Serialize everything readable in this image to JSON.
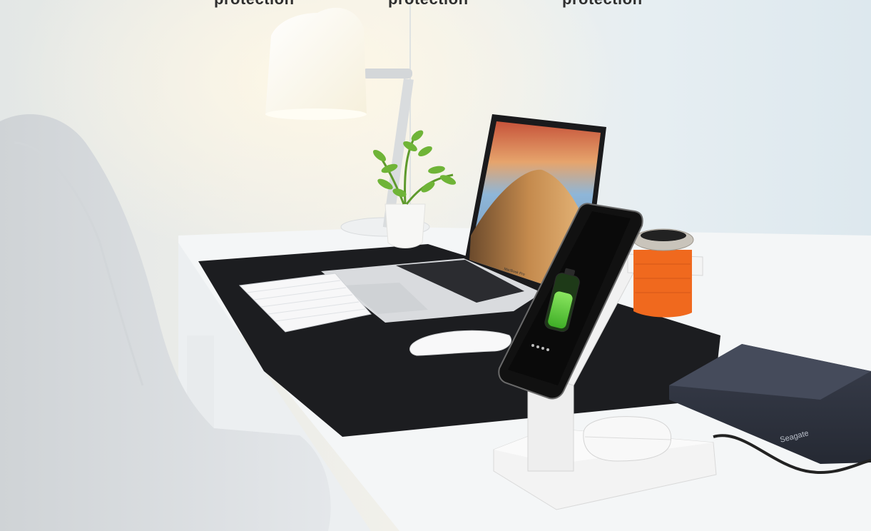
{
  "captions": [
    "protection",
    "protection",
    "protection"
  ],
  "device_brand": "Seagate",
  "laptop_brand": "MacBook Pro",
  "colors": {
    "wall": "#e9eff3",
    "desk": "#f4f6f7",
    "desk_mat": "#1c1d20",
    "charger": "#f3f3f3",
    "watch_band": "#f0691e",
    "battery_fill": "#5cd23a",
    "lamp_glow": "#fff8e6"
  }
}
